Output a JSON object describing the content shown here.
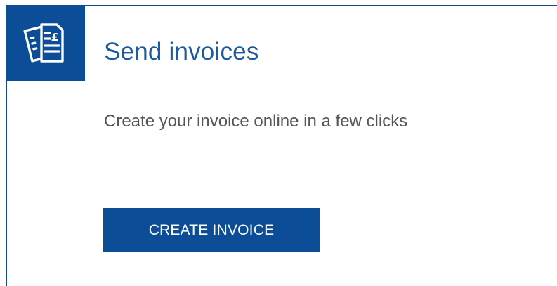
{
  "card": {
    "icon": "invoice-pound-icon",
    "title": "Send invoices",
    "description": "Create your invoice online in a few clicks",
    "button_label": "CREATE INVOICE"
  },
  "colors": {
    "brand_blue": "#0b4d97",
    "title_blue": "#1e5aa0",
    "text_gray": "#555555"
  }
}
